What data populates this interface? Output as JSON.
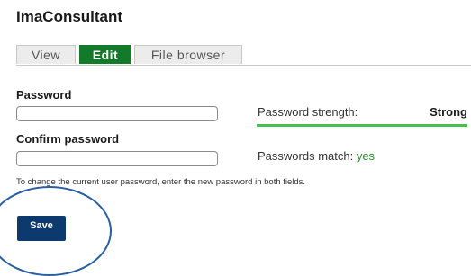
{
  "page": {
    "title": "ImaConsultant"
  },
  "tabs": [
    {
      "label": "View",
      "active": false
    },
    {
      "label": "Edit",
      "active": true
    },
    {
      "label": "File browser",
      "active": false
    }
  ],
  "form": {
    "password_label": "Password",
    "password_value": "",
    "confirm_label": "Confirm password",
    "confirm_value": "",
    "strength_label": "Password strength:",
    "strength_value": "Strong",
    "strength_level": 1.0,
    "match_label": "Passwords match:",
    "match_value": "yes",
    "help_text": "To change the current user password, enter the new password in both fields."
  },
  "actions": {
    "save_label": "Save"
  },
  "colors": {
    "active_tab": "#127a2a",
    "strength_bar": "#47c04c",
    "save_button": "#0d3a6e",
    "highlight_ring": "#2a5fa0",
    "match_value": "#2a8a2a"
  }
}
